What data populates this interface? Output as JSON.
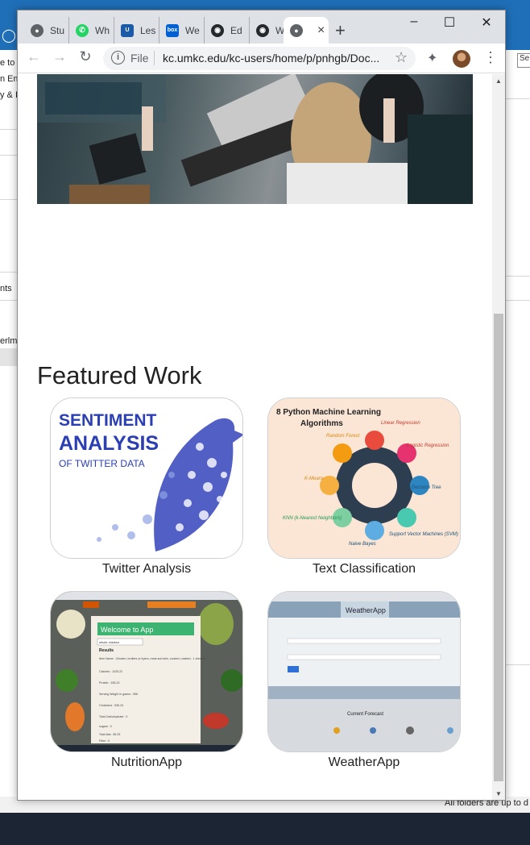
{
  "background": {
    "left_fragments": [
      "e to",
      "n Em",
      "y & I",
      "nts",
      "erlm"
    ],
    "right_search": "Se",
    "status": "All folders are up to d"
  },
  "browser": {
    "tabs": [
      {
        "label": "Stu",
        "icon": "globe-icon"
      },
      {
        "label": "Wh",
        "icon": "whatsapp-icon"
      },
      {
        "label": "Les",
        "icon": "umkc-icon"
      },
      {
        "label": "We",
        "icon": "box-icon"
      },
      {
        "label": "Ed",
        "icon": "github-icon"
      },
      {
        "label": "We",
        "icon": "github-icon"
      },
      {
        "label": "",
        "icon": "globe-icon",
        "active": true
      }
    ],
    "address": {
      "scheme_label": "File",
      "url": "kc.umkc.edu/kc-users/home/p/pnhgb/Doc..."
    }
  },
  "page": {
    "featured_heading": "Featured Work",
    "projects": [
      {
        "caption": "Twitter Analysis",
        "thumb_title": "SENTIMENT ANALYSIS",
        "thumb_sub": "OF TWITTER DATA"
      },
      {
        "caption": "Text Classification",
        "thumb_title": "8 Python Machine Learning Algorithms",
        "thumb_labels": [
          "Linear Regression",
          "Logistic Regression",
          "Decision Tree",
          "Support Vector Machines (SVM)",
          "Naive Bayes",
          "KNN (k-Nearest Neighbors)",
          "K-Means",
          "Random Forest"
        ]
      },
      {
        "caption": "NutritionApp",
        "thumb_title": "Welcome to App",
        "thumb_query": "whole chicken",
        "thumb_results": "Results",
        "thumb_lines": [
          "Item Name : Chicken, broilers or fryers, meat and skin, cooked, roasted - 1 chicken",
          "Calories : 1425.22",
          "Protein : 155.23",
          "Serving Weight in grams : 596",
          "Cholestrol : 536.24",
          "Total Carbohydrate : 0",
          "sugars : 0",
          "Total fats : 85.33",
          "Fiber : 0"
        ]
      },
      {
        "caption": "WeatherApp",
        "thumb_title": "WeatherApp",
        "thumb_forecast": "Current Forecast"
      }
    ]
  },
  "colors": {
    "sentiment_blue": "#2b3fb3",
    "chrome_tabstrip": "#dee1e6",
    "taskbar": "#1c2533"
  }
}
